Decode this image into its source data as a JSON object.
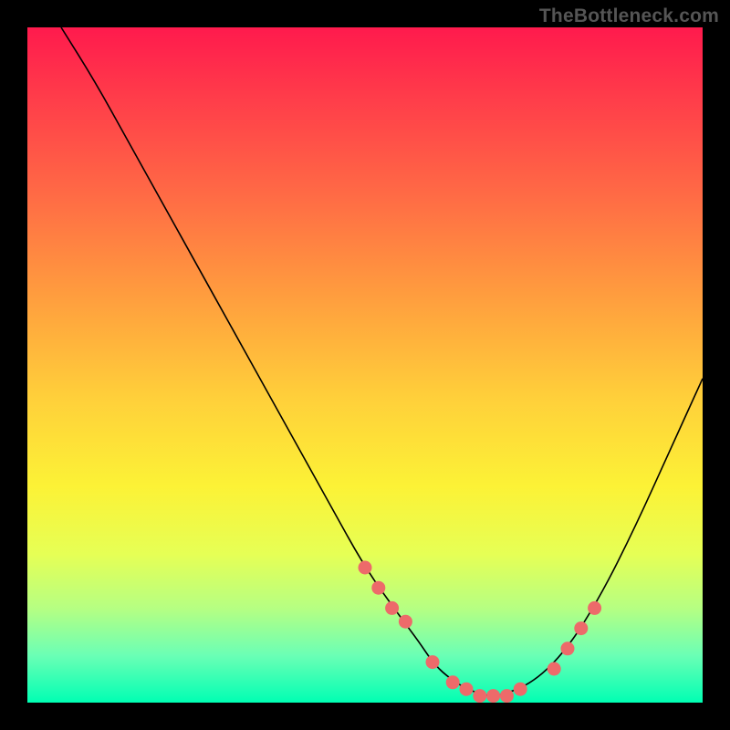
{
  "watermark": "TheBottleneck.com",
  "chart_data": {
    "type": "line",
    "title": "",
    "xlabel": "",
    "ylabel": "",
    "xlim": [
      0,
      100
    ],
    "ylim": [
      0,
      100
    ],
    "background_gradient": {
      "top": "#ff1a4d",
      "bottom": "#00ffb3",
      "meaning": "top = high bottleneck, bottom = low bottleneck"
    },
    "series": [
      {
        "name": "bottleneck-curve",
        "x": [
          5,
          10,
          15,
          20,
          25,
          30,
          35,
          40,
          45,
          50,
          55,
          58,
          60,
          62,
          65,
          68,
          70,
          75,
          80,
          85,
          90,
          95,
          100
        ],
        "y": [
          100,
          92,
          83,
          74,
          65,
          56,
          47,
          38,
          29,
          20,
          13,
          9,
          6,
          4,
          2,
          1,
          1,
          3,
          8,
          16,
          26,
          37,
          48
        ]
      }
    ],
    "marked_points": {
      "name": "highlighted-dots",
      "x": [
        50,
        52,
        54,
        56,
        60,
        63,
        65,
        67,
        69,
        71,
        73,
        78,
        80,
        82,
        84
      ],
      "y": [
        20,
        17,
        14,
        12,
        6,
        3,
        2,
        1,
        1,
        1,
        2,
        5,
        8,
        11,
        14
      ]
    }
  }
}
